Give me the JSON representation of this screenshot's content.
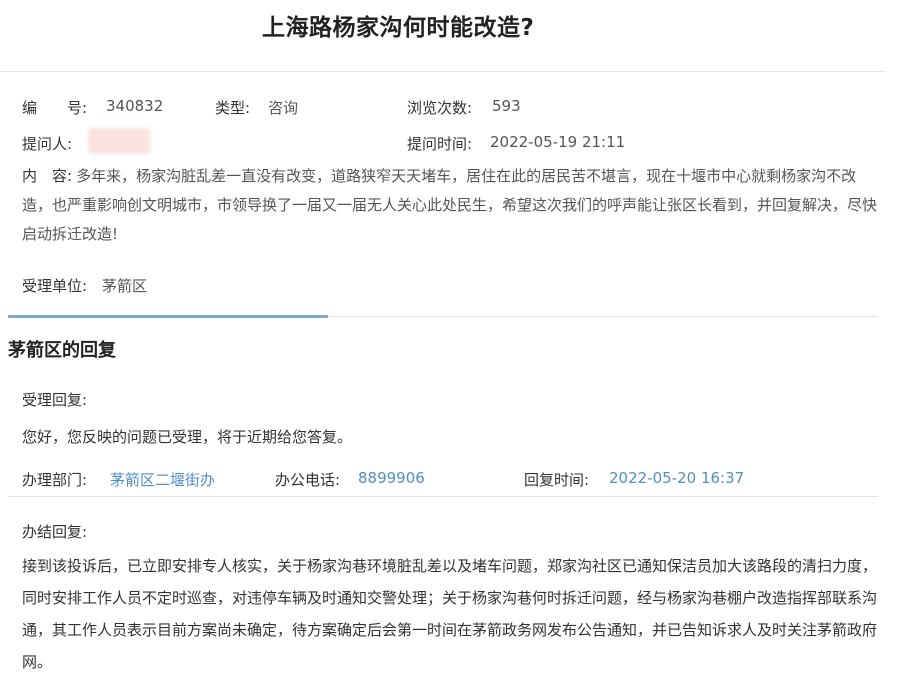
{
  "question": {
    "title": "上海路杨家沟何时能改造?",
    "number_label": "编　　号:",
    "number": "340832",
    "type_label": "类型:",
    "type": "咨询",
    "views_label": "浏览次数:",
    "views": "593",
    "asker_label": "提问人:",
    "time_label": "提问时间:",
    "time": "2022-05-19 21:11",
    "content_label": "内　容:",
    "content": "多年来，杨家沟脏乱差一直没有改变，道路狭窄天天堵车，居住在此的居民苦不堪言，现在十堰市中心就剩杨家沟不改造，也严重影响创文明城市，市领导换了一届又一届无人关心此处民生，希望这次我们的呼声能让张区长看到，并回复解决，尽快启动拆迁改造!",
    "unit_label": "受理单位:",
    "unit": "茅箭区"
  },
  "reply": {
    "section_title": "茅箭区的回复",
    "accept_label": "受理回复:",
    "accept_text": "您好，您反映的问题已受理，将于近期给您答复。",
    "dept_label": "办理部门:",
    "dept": "茅箭区二堰街办",
    "phone_label": "办公电话:",
    "phone": "8899906",
    "reply_time_label": "回复时间:",
    "reply_time": "2022-05-20 16:37",
    "final_label": "办结回复:",
    "final_text": "接到该投诉后，已立即安排专人核实，关于杨家沟巷环境脏乱差以及堵车问题，郑家沟社区已通知保洁员加大该路段的清扫力度，同时安排工作人员不定时巡查，对违停车辆及时通知交警处理；关于杨家沟巷何时拆迁问题，经与杨家沟巷棚户改造指挥部联系沟通，其工作人员表示目前方案尚未确定，待方案确定后会第一时间在茅箭政务网发布公告通知，并已告知诉求人及时关注茅箭政府网。"
  },
  "colors": {
    "link_blue": "#4f8fc7",
    "tab_accent": "#7aa6cf"
  }
}
